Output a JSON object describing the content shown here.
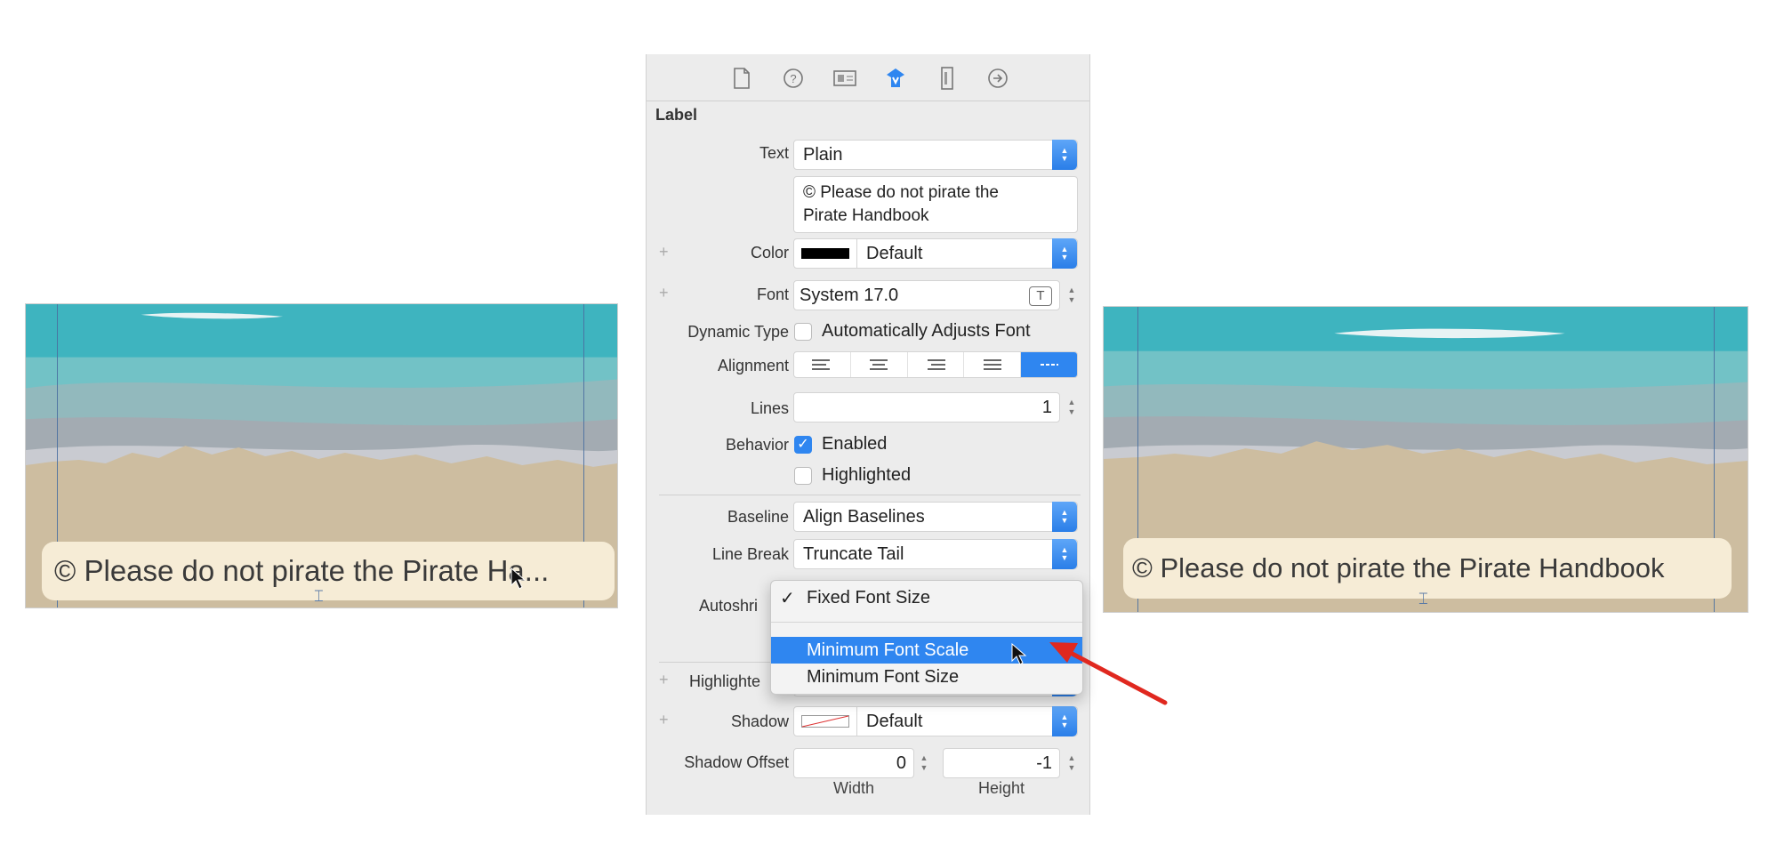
{
  "preview_left": {
    "label_text": "© Please do not pirate the Pirate Ha..."
  },
  "preview_right": {
    "label_text": "© Please do not pirate the Pirate Handbook"
  },
  "inspector": {
    "section_title": "Label",
    "tabs": [
      "file-icon",
      "help-icon",
      "identity-icon",
      "attributes-icon",
      "size-icon",
      "connections-icon"
    ],
    "text": {
      "label": "Text",
      "value": "Plain",
      "content_line1": "© Please do not pirate the",
      "content_line2": "Pirate Handbook"
    },
    "color": {
      "label": "Color",
      "value": "Default",
      "swatch": "#000000"
    },
    "font": {
      "label": "Font",
      "value": "System 17.0",
      "icon_letter": "T"
    },
    "dynamic_type": {
      "label": "Dynamic Type",
      "checkbox_label": "Automatically Adjusts Font",
      "checked": false
    },
    "alignment": {
      "label": "Alignment",
      "selected_index": 4
    },
    "lines": {
      "label": "Lines",
      "value": "1"
    },
    "behavior": {
      "label": "Behavior",
      "enabled_label": "Enabled",
      "enabled": true,
      "highlighted_label": "Highlighted",
      "highlighted": false
    },
    "baseline": {
      "label": "Baseline",
      "value": "Align Baselines"
    },
    "line_break": {
      "label": "Line Break",
      "value": "Truncate Tail"
    },
    "autoshrink": {
      "label": "Autoshri",
      "menu_items": [
        {
          "label": "Fixed Font Size",
          "checked": true
        },
        {
          "label": "Minimum Font Scale",
          "highlighted": true
        },
        {
          "label": "Minimum Font Size"
        }
      ]
    },
    "highlighted_color": {
      "label": "Highlighte"
    },
    "shadow": {
      "label": "Shadow",
      "value": "Default"
    },
    "shadow_offset": {
      "label": "Shadow Offset",
      "width_value": "0",
      "height_value": "-1",
      "width_label": "Width",
      "height_label": "Height"
    }
  },
  "colors": {
    "accent": "#2f86f0",
    "arrow": "#e0281f"
  }
}
